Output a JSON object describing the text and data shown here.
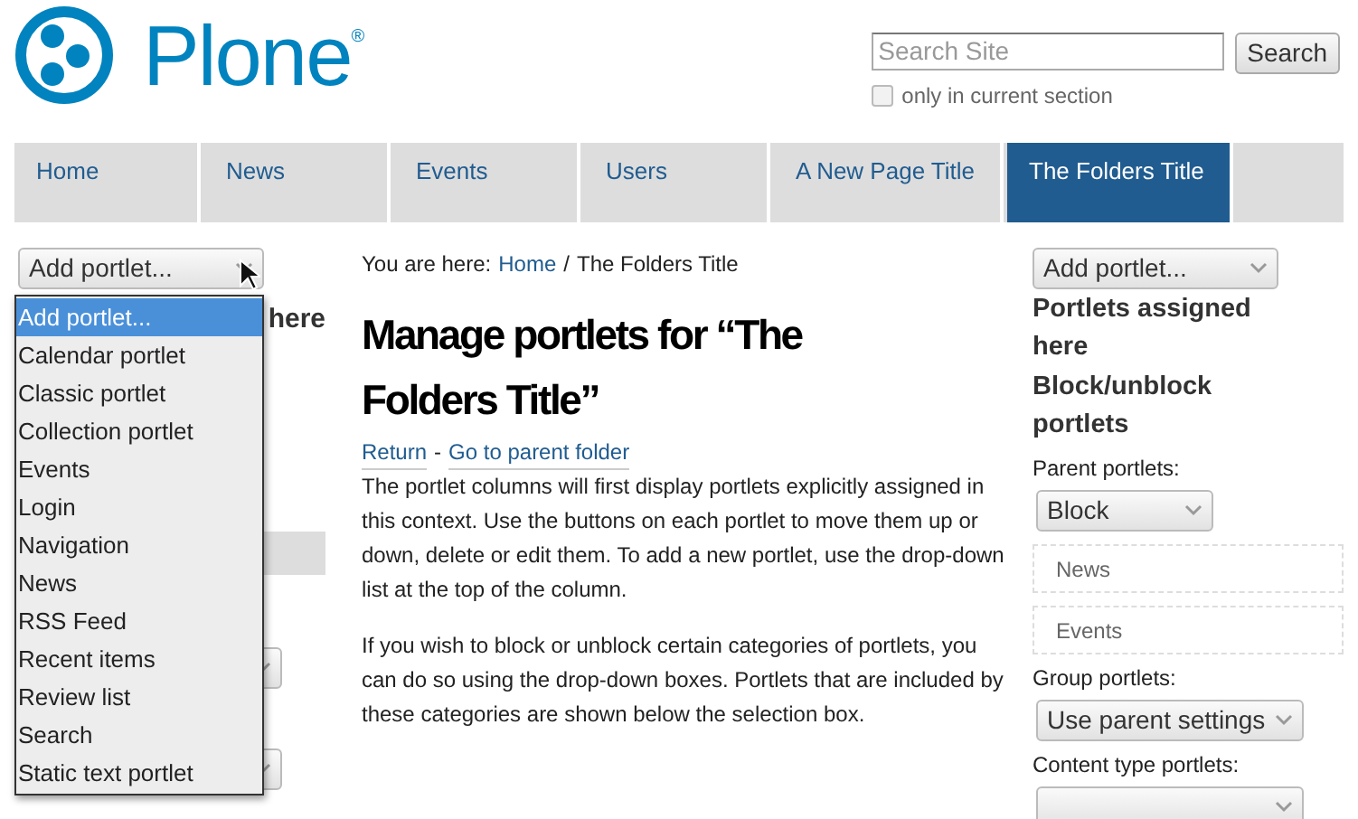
{
  "logo": {
    "name": "Plone",
    "mark": "®"
  },
  "search": {
    "placeholder": "Search Site",
    "button": "Search",
    "option": {
      "label": "only in current section",
      "checked": false
    }
  },
  "nav": [
    {
      "label": "Home",
      "selected": false
    },
    {
      "label": "News",
      "selected": false
    },
    {
      "label": "Events",
      "selected": false
    },
    {
      "label": "Users",
      "selected": false
    },
    {
      "label": "A New Page Title",
      "selected": false
    },
    {
      "label": "The Folders Title",
      "selected": true
    }
  ],
  "left_column": {
    "select": "Add portlet...",
    "heading": "here",
    "dropdown": {
      "expanded": true,
      "options": [
        {
          "label": "Add portlet...",
          "selected": true
        },
        {
          "label": "Calendar portlet",
          "selected": false
        },
        {
          "label": "Classic portlet",
          "selected": false
        },
        {
          "label": "Collection portlet",
          "selected": false
        },
        {
          "label": "Events",
          "selected": false
        },
        {
          "label": "Login",
          "selected": false
        },
        {
          "label": "Navigation",
          "selected": false
        },
        {
          "label": "News",
          "selected": false
        },
        {
          "label": "RSS Feed",
          "selected": false
        },
        {
          "label": "Recent items",
          "selected": false
        },
        {
          "label": "Review list",
          "selected": false
        },
        {
          "label": "Search",
          "selected": false
        },
        {
          "label": "Static text portlet",
          "selected": false
        }
      ]
    }
  },
  "breadcrumb": {
    "prefix": "You are here:",
    "items": [
      {
        "label": "Home",
        "link": true
      },
      {
        "label": "The Folders Title",
        "link": false
      }
    ],
    "separator": "/"
  },
  "title": "Manage portlets for “The Folders Title”",
  "links": {
    "items": [
      "Return",
      "Go to parent folder"
    ],
    "separator": "-"
  },
  "paragraphs": [
    "The portlet columns will first display portlets explicitly assigned in this context. Use the buttons on each portlet to move them up or down, delete or edit them. To add a new portlet, use the drop-down list at the top of the column.",
    "If you wish to block or unblock certain categories of portlets, you can do so using the drop-down boxes. Portlets that are included by these categories are shown below the selection box."
  ],
  "right_column": {
    "select": "Add portlet...",
    "headings": [
      "Portlets assigned here",
      "Block/unblock portlets"
    ],
    "groups": [
      {
        "label": "Parent portlets:",
        "select": "Block",
        "portlets": [
          "News",
          "Events"
        ]
      },
      {
        "label": "Group portlets:",
        "select": "Use parent settings"
      },
      {
        "label": "Content type portlets:"
      }
    ]
  }
}
